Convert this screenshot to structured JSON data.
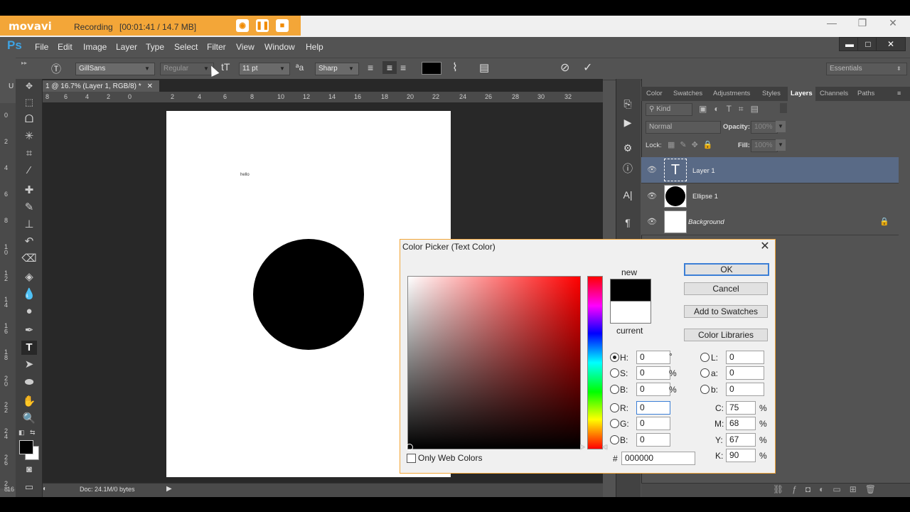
{
  "recorder": {
    "logo": "movavi",
    "status": "Recording",
    "time": "[00:01:41 / 14.7 MB]"
  },
  "window_controls": {
    "minimize": "—",
    "restore": "❐",
    "close": "✕"
  },
  "app": {
    "logo": "Ps"
  },
  "menu": [
    "File",
    "Edit",
    "Image",
    "Layer",
    "Type",
    "Select",
    "Filter",
    "View",
    "Window",
    "Help"
  ],
  "options": {
    "font_family": "GillSans",
    "font_style": "Regular",
    "font_size": "11 pt",
    "antialias": "Sharp",
    "text_color": "#000000",
    "workspace": "Essentials"
  },
  "document": {
    "tab_title": "1 @ 16.7% (Layer 1, RGB/8) *",
    "tab_prefix": "U",
    "canvas_text": "hello",
    "status": "Doc: 24.1M/0 bytes",
    "zoom": "16",
    "ruler_h": [
      "8",
      "6",
      "4",
      "2",
      "0",
      "2",
      "4",
      "6",
      "8",
      "10",
      "12",
      "14",
      "16",
      "18",
      "20",
      "22",
      "24",
      "26",
      "28",
      "30",
      "32"
    ],
    "ruler_v": [
      "0",
      "2",
      "4",
      "6",
      "8",
      "1\n0",
      "1\n2",
      "1\n4",
      "1\n6",
      "1\n8",
      "2\n0",
      "2\n2",
      "2\n4",
      "2\n6",
      "2\n8"
    ]
  },
  "panels": {
    "tabs": [
      "Color",
      "Swatches",
      "Adjustments",
      "Styles",
      "Layers",
      "Channels",
      "Paths"
    ],
    "active_tab": "Layers",
    "filter": "Kind",
    "blend_mode": "Normal",
    "opacity_label": "Opacity:",
    "opacity": "100%",
    "lock_label": "Lock:",
    "fill_label": "Fill:",
    "fill": "100%",
    "layers": [
      {
        "name": "Layer 1",
        "type": "text",
        "selected": true
      },
      {
        "name": "Ellipse 1",
        "type": "shape",
        "selected": false
      },
      {
        "name": "Background",
        "type": "background",
        "selected": false,
        "locked": true
      }
    ]
  },
  "color_picker": {
    "title": "Color Picker (Text Color)",
    "new_label": "new",
    "current_label": "current",
    "new_color": "#000000",
    "current_color": "#ffffff",
    "buttons": {
      "ok": "OK",
      "cancel": "Cancel",
      "add": "Add to Swatches",
      "libraries": "Color Libraries"
    },
    "only_web": "Only Web Colors",
    "hsb": [
      {
        "label": "H:",
        "value": "0",
        "unit": "°",
        "selected": true
      },
      {
        "label": "S:",
        "value": "0",
        "unit": "%",
        "selected": false
      },
      {
        "label": "B:",
        "value": "0",
        "unit": "%",
        "selected": false
      }
    ],
    "rgb": [
      {
        "label": "R:",
        "value": "0"
      },
      {
        "label": "G:",
        "value": "0"
      },
      {
        "label": "B:",
        "value": "0"
      }
    ],
    "lab": [
      {
        "label": "L:",
        "value": "0"
      },
      {
        "label": "a:",
        "value": "0"
      },
      {
        "label": "b:",
        "value": "0"
      }
    ],
    "cmyk": [
      {
        "label": "C:",
        "value": "75",
        "unit": "%"
      },
      {
        "label": "M:",
        "value": "68",
        "unit": "%"
      },
      {
        "label": "Y:",
        "value": "67",
        "unit": "%"
      },
      {
        "label": "K:",
        "value": "90",
        "unit": "%"
      }
    ],
    "hex_label": "#",
    "hex": "000000"
  }
}
